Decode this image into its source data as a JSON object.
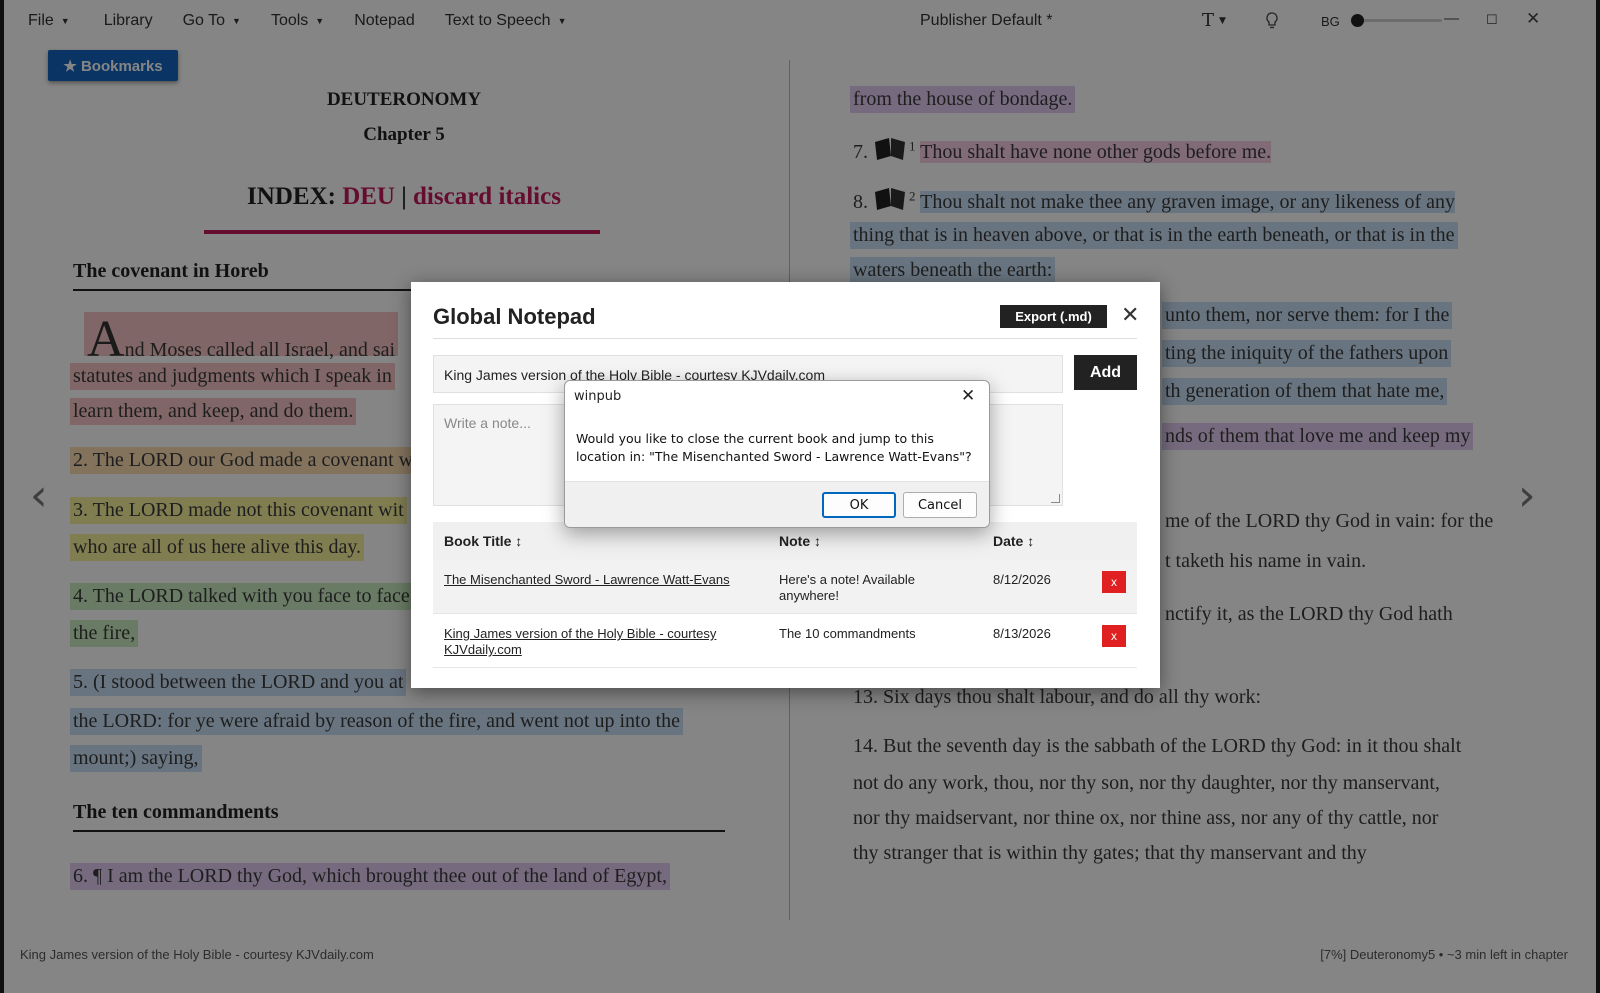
{
  "menubar": {
    "items": [
      {
        "label": "File",
        "caret": true
      },
      {
        "label": "Library",
        "caret": false
      },
      {
        "label": "Go To",
        "caret": true
      },
      {
        "label": "Tools",
        "caret": true
      },
      {
        "label": "Notepad",
        "caret": false
      },
      {
        "label": "Text to Speech",
        "caret": true
      }
    ],
    "publisher": "Publisher Default *",
    "font_button": "T",
    "bg_label": "BG"
  },
  "bookmarks": {
    "label": "★ Bookmarks"
  },
  "reader": {
    "book": "DEUTERONOMY",
    "chapter": "Chapter 5",
    "index_label": "INDEX:",
    "index_link1": "DEU",
    "index_sep": "|",
    "index_link2": "discard italics",
    "section1": "The covenant in Horeb",
    "section2": "The ten commandments",
    "left_lines": [
      "nd Moses called all Israel, and sai",
      "statutes and judgments which I speak in",
      "learn them, and keep, and do them.",
      "2. The LORD our God made a covenant w",
      "3. The LORD made not this covenant wit",
      "who are all of us here alive this day.",
      "4. The LORD talked with you face to face",
      "the fire,",
      "5. (I stood between the LORD and you at",
      "the LORD: for ye were afraid by reason of the fire, and went not up into the",
      "mount;) saying,",
      "6. ¶ I am the LORD thy God, which brought thee out of the land of Egypt,"
    ],
    "dropcap": "A",
    "right_lines": [
      "from the house of bondage.",
      "Thou shalt have none other gods before me.",
      "Thou shalt not make thee any graven image, or any likeness of any",
      "thing that is in heaven above, or that is in the earth beneath, or that is in the",
      "waters beneath the earth:",
      "unto them, nor serve them: for I the",
      "ting the iniquity of the fathers upon",
      "th generation of them that hate me,",
      "nds of them that love me and keep my",
      "me of the LORD thy God in vain: for the",
      "t taketh his name in vain.",
      "nctify it, as the LORD thy God hath",
      "13. Six days thou shalt labour, and do all thy work:",
      "14. But the seventh day is the sabbath of the LORD thy God: in it thou shalt",
      "not do any work, thou, nor thy son, nor thy daughter, nor thy manservant,",
      "nor thy maidservant, nor thine ox, nor thine ass, nor any of thy cattle, nor",
      "thy stranger that is within thy gates; that thy manservant and thy"
    ],
    "verse7_num": "7.",
    "verse7_sup": "1",
    "verse8_num": "8.",
    "verse8_sup": "2"
  },
  "status": {
    "left": "King James version of the Holy Bible - courtesy KJVdaily.com",
    "right": "[7%] Deuteronomy5 • ~3 min left in chapter"
  },
  "notepad": {
    "title": "Global Notepad",
    "export_label": "Export (.md)",
    "book_value": "King James version of the Holy Bible - courtesy KJVdaily.com",
    "add_label": "Add",
    "note_placeholder": "Write a note...",
    "columns": [
      "Book Title ↕",
      "Note ↕",
      "Date ↕"
    ],
    "rows": [
      {
        "book": "The Misenchanted Sword - Lawrence Watt-Evans",
        "note": "Here's a note! Available anywhere!",
        "date": "8/12/2026",
        "delete": "x"
      },
      {
        "book": "King James version of the Holy Bible - courtesy KJVdaily.com",
        "note": "The 10 commandments",
        "date": "8/13/2026",
        "delete": "x"
      }
    ]
  },
  "dialog": {
    "title": "winpub",
    "message": "Would you like to close the current book and jump to this location in: \"The Misenchanted Sword - Lawrence Watt-Evans\"?",
    "ok_label": "OK",
    "cancel_label": "Cancel"
  },
  "colors": {
    "accent": "#c2185b",
    "bookmark_button": "#1565c0",
    "delete_button": "#e02020"
  }
}
